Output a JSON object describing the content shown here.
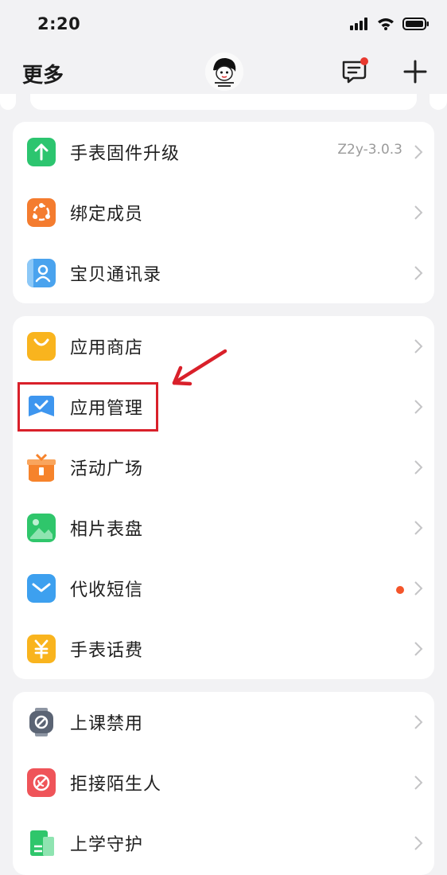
{
  "status_bar": {
    "time": "2:20"
  },
  "nav": {
    "title": "更多",
    "avatar_icon": "cartoon-avatar"
  },
  "card1": {
    "items": [
      {
        "label": "手表固件升级",
        "value": "Z2y-3.0.3",
        "icon": "upload-arrow-icon",
        "color": "#2cc56f"
      },
      {
        "label": "绑定成员",
        "icon": "members-icon",
        "color": "#f47c2f"
      },
      {
        "label": "宝贝通讯录",
        "icon": "contacts-icon",
        "color": "#4aa3ee"
      }
    ]
  },
  "card2": {
    "items": [
      {
        "label": "应用商店",
        "icon": "shopping-bag-icon",
        "color": "#f9b41e"
      },
      {
        "label": "应用管理",
        "icon": "app-manage-icon",
        "color": "#3e96ef"
      },
      {
        "label": "活动广场",
        "icon": "gift-icon",
        "color": "#f6832b"
      },
      {
        "label": "相片表盘",
        "icon": "photo-icon",
        "color": "#2fc66b"
      },
      {
        "label": "代收短信",
        "icon": "message-icon",
        "color": "#3da0ef"
      },
      {
        "label": "手表话费",
        "icon": "yuan-icon",
        "color": "#f9b41e"
      }
    ]
  },
  "card3": {
    "items": [
      {
        "label": "上课禁用",
        "icon": "disable-watch-icon",
        "color": "#5b6474"
      },
      {
        "label": "拒接陌生人",
        "icon": "block-call-icon",
        "color": "#ef5459"
      },
      {
        "label": "上学守护",
        "icon": "school-guard-icon",
        "color": "#2fc66b"
      }
    ]
  },
  "colors": {
    "accent_red": "#d9202a",
    "badge": "#f4552a"
  }
}
